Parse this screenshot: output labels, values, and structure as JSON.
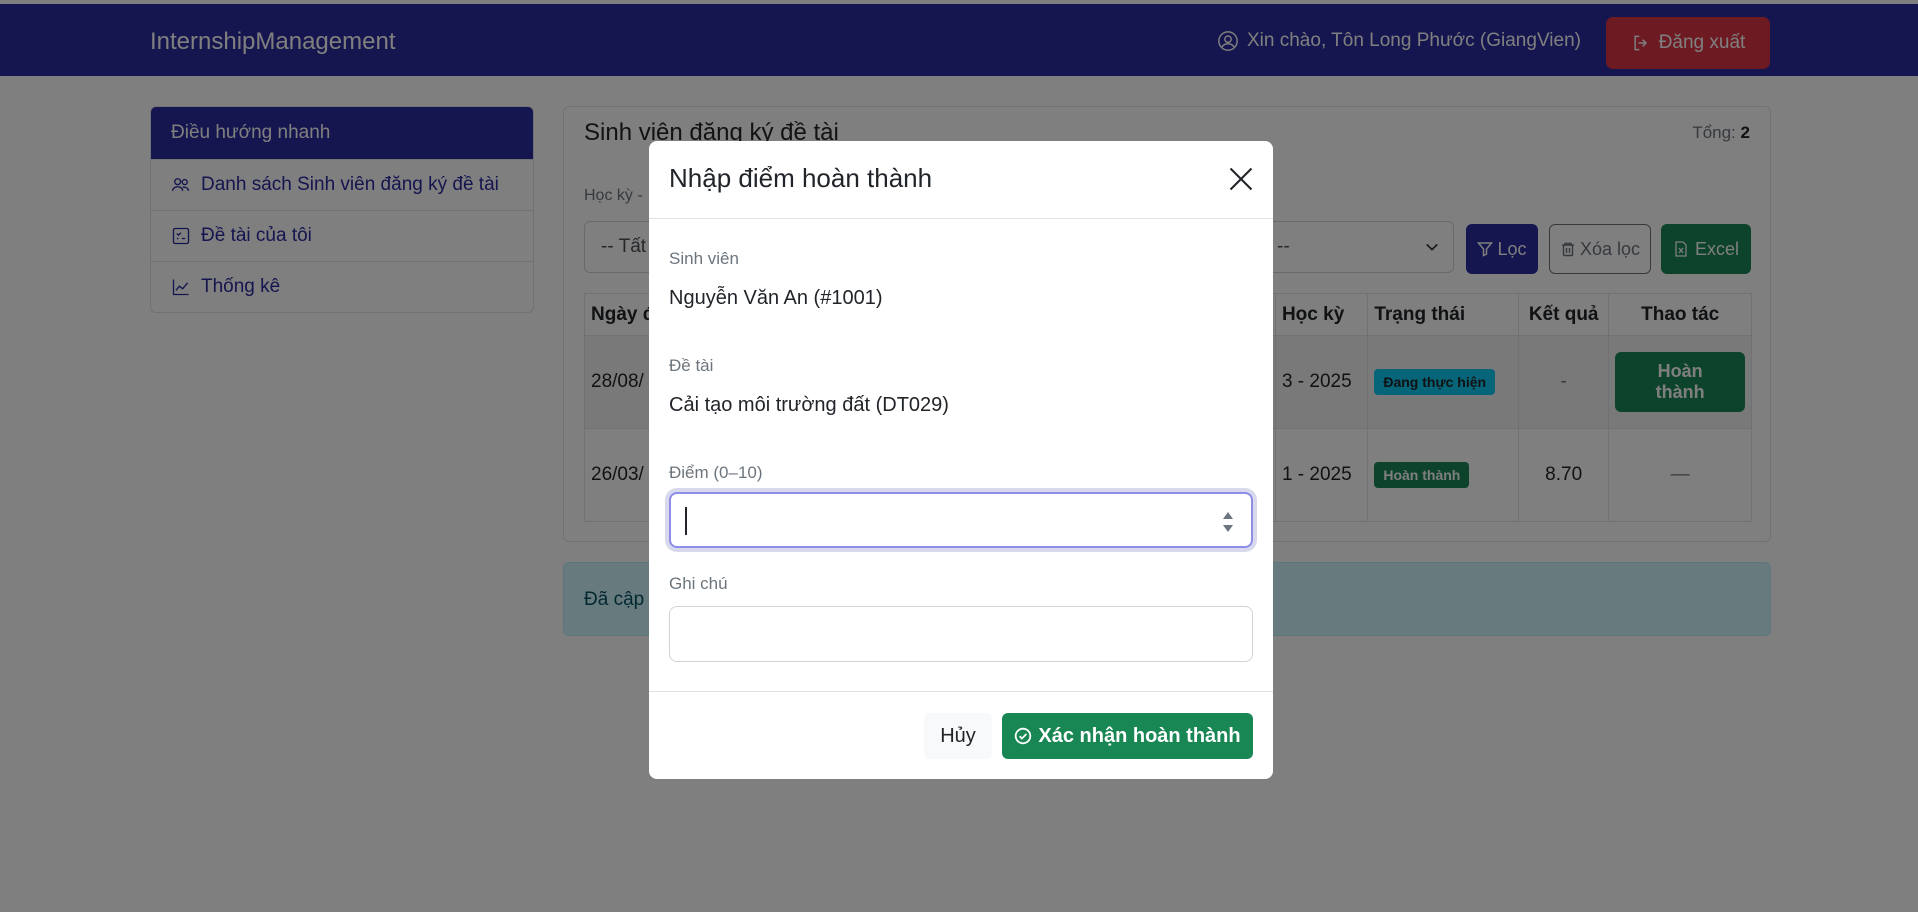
{
  "navbar": {
    "brand": "InternshipManagement",
    "greeting": "Xin chào, Tôn Long Phước (GiangVien)",
    "logout_label": "Đăng xuất"
  },
  "sidebar": {
    "header": "Điều hướng nhanh",
    "items": [
      {
        "label": "Danh sách Sinh viên đăng ký đề tài",
        "icon": "people-icon"
      },
      {
        "label": "Đề tài của tôi",
        "icon": "checklist-icon"
      },
      {
        "label": "Thống kê",
        "icon": "chart-line-icon"
      }
    ]
  },
  "main": {
    "title": "Sinh viên đăng ký đề tài",
    "total_label": "Tổng:",
    "total_value": "2",
    "filter_label": "Học kỳ -",
    "filter_select_1": "-- Tất",
    "filter_select_2": "--",
    "filter_button": "Lọc",
    "clear_button": "Xóa lọc",
    "excel_button": "Excel",
    "table": {
      "headers": [
        "Ngày đ",
        "Học kỳ",
        "Trạng thái",
        "Kết quả",
        "Thao tác"
      ],
      "rows": [
        {
          "date": "28/08/",
          "term": "3 - 2025",
          "status": "Đang thực hiện",
          "result": "-",
          "action": "Hoàn thành"
        },
        {
          "date": "26/03/",
          "term": "1 - 2025",
          "status": "Hoàn thành",
          "result": "8.70",
          "action": "—"
        }
      ]
    },
    "alert": "Đã cập"
  },
  "modal": {
    "title": "Nhập điểm hoàn thành",
    "student_label": "Sinh viên",
    "student_value": "Nguyễn Văn An (#1001)",
    "topic_label": "Đề tài",
    "topic_value": "Cải tạo môi trường đất (DT029)",
    "score_label": "Điểm (0–10)",
    "score_value": "",
    "note_label": "Ghi chú",
    "note_value": "",
    "cancel_label": "Hủy",
    "confirm_label": "Xác nhận hoàn thành"
  },
  "colors": {
    "primary": "#2a2a9e",
    "danger": "#dc3545",
    "success": "#198754",
    "info": "#0dcaf0"
  }
}
